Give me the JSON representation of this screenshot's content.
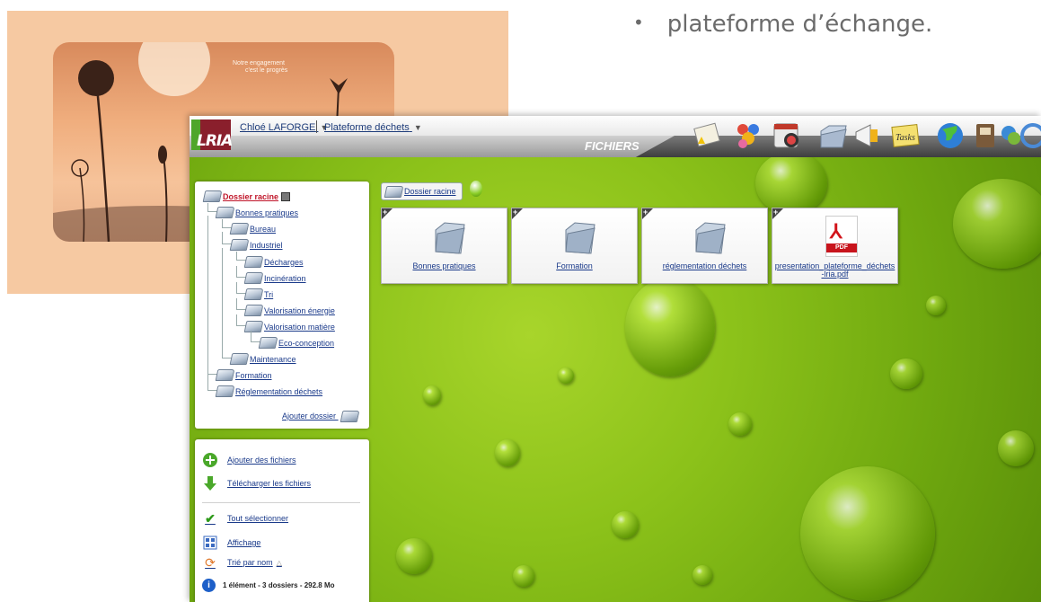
{
  "slide": {
    "bullet": "plateforme d’échange.",
    "photo_caption_1": "Notre engagement",
    "photo_caption_2": "c'est le progrès"
  },
  "header": {
    "logo": "LRIA",
    "user_menu": "Chloé LAFORGE",
    "platform_menu": "Plateforme déchets",
    "section_title": "FICHIERS",
    "toolbar_icons": [
      "news-icon",
      "users-icon",
      "calendar-icon",
      "folder-icon",
      "megaphone-icon",
      "tasks-icon",
      "globe-icon",
      "address-book-icon",
      "contacts-icon",
      "sync-icon"
    ],
    "tasks_label": "Tasks"
  },
  "tree": {
    "root": "Dossier racine",
    "items": [
      {
        "label": "Bonnes pratiques",
        "level": 1
      },
      {
        "label": "Bureau",
        "level": 2
      },
      {
        "label": "Industriel",
        "level": 2
      },
      {
        "label": "Décharges",
        "level": 3
      },
      {
        "label": "Incinération",
        "level": 3
      },
      {
        "label": "Tri",
        "level": 3
      },
      {
        "label": "Valorisation énergie",
        "level": 3
      },
      {
        "label": "Valorisation matière",
        "level": 3
      },
      {
        "label": "Eco-conception",
        "level": 4
      },
      {
        "label": "Maintenance",
        "level": 2
      },
      {
        "label": "Formation",
        "level": 1
      },
      {
        "label": "Réglementation déchets",
        "level": 1
      }
    ],
    "add_folder": "Ajouter dossier"
  },
  "actions": {
    "add_files": "Ajouter des fichiers",
    "download_files": "Télécharger les fichiers",
    "select_all": "Tout sélectionner",
    "display": "Affichage",
    "sort": "Trié par nom",
    "status": "1 élément  -  3 dossiers  -  292.8 Mo"
  },
  "main": {
    "breadcrumb": "Dossier racine",
    "tiles": [
      {
        "label": "Bonnes pratiques",
        "kind": "folder"
      },
      {
        "label": "Formation",
        "kind": "folder"
      },
      {
        "label": "réglementation déchets",
        "kind": "folder"
      },
      {
        "label": "presentation_plateforme_déchets-lria.pdf",
        "kind": "pdf"
      }
    ],
    "pdf_badge": "PDF"
  },
  "colors": {
    "link": "#1a3a8a",
    "root_red": "#c0162a",
    "background_green": "#8cc21a",
    "logo_red": "#8a1f2c",
    "logo_green": "#4ea62b"
  }
}
